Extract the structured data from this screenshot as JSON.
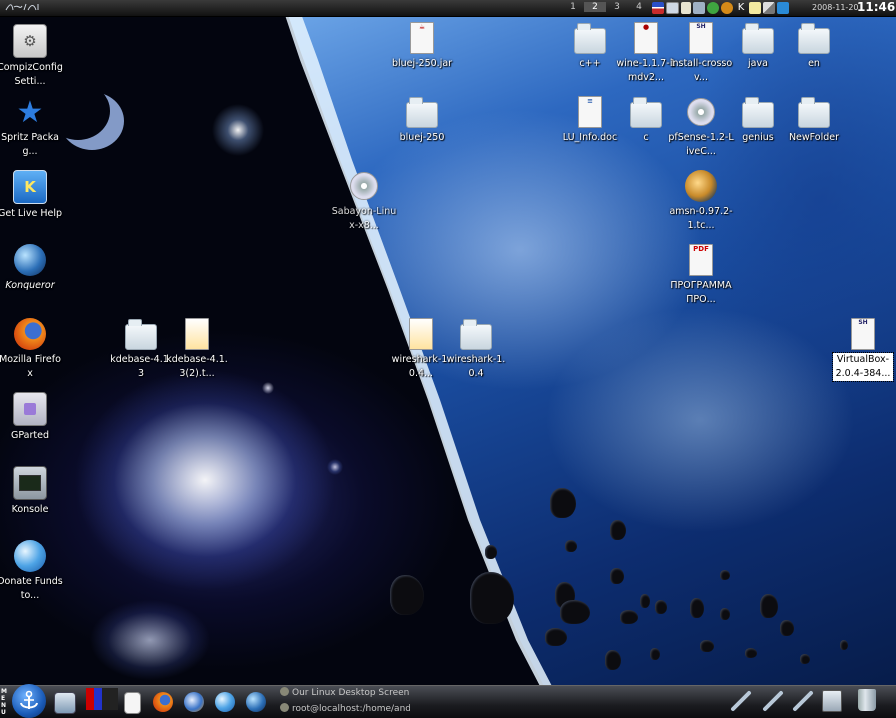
{
  "top_panel": {
    "desktops": [
      "1",
      "2",
      "3",
      "4"
    ],
    "active_desktop": "2",
    "tray_icons": [
      "flag-icon",
      "screen-icon",
      "clipboard-icon",
      "printer-icon",
      "green-apple-icon",
      "gear-icon",
      "k-icon",
      "notes-icon",
      "network-icon",
      "notify-icon"
    ],
    "date": "2008-11-20",
    "time": "11:46"
  },
  "desktop": {
    "left_column": [
      {
        "label": "CompizConfig Setti...",
        "icon": "compiz-config-icon"
      },
      {
        "label": "Spritz Packag...",
        "icon": "star-icon"
      },
      {
        "label": "Get Live Help",
        "icon": "k-help-icon"
      },
      {
        "label": "Konqueror",
        "icon": "konqueror-icon"
      },
      {
        "label": "Mozilla Firefox",
        "icon": "firefox-icon"
      },
      {
        "label": "GParted",
        "icon": "gparted-icon"
      },
      {
        "label": "Konsole",
        "icon": "konsole-icon"
      },
      {
        "label": "Donate Funds to...",
        "icon": "globe-icon"
      }
    ],
    "middle": [
      {
        "label": "kdebase-4.1.3",
        "icon": "folder-icon"
      },
      {
        "label": "kdebase-4.1.3(2).t...",
        "icon": "archive-icon"
      },
      {
        "label": "bluej-250.jar",
        "icon": "java-file-icon"
      },
      {
        "label": "bluej-250",
        "icon": "folder-icon"
      },
      {
        "label": "Sabayon-Linux-x8...",
        "icon": "disc-image-icon"
      },
      {
        "label": "wireshark-1.0.4...",
        "icon": "archive-icon"
      },
      {
        "label": "wireshark-1.0.4",
        "icon": "folder-icon"
      }
    ],
    "right_grid": [
      {
        "label": "c++",
        "icon": "folder-icon"
      },
      {
        "label": "wine-1.1.7-1mdv2...",
        "icon": "rpm-icon"
      },
      {
        "label": "install-crossov...",
        "icon": "script-icon"
      },
      {
        "label": "java",
        "icon": "folder-icon"
      },
      {
        "label": "en",
        "icon": "folder-icon"
      },
      {
        "label": "LU_Info.doc",
        "icon": "doc-file-icon"
      },
      {
        "label": "c",
        "icon": "folder-icon"
      },
      {
        "label": "pfSense-1.2-LiveC...",
        "icon": "disc-image-icon"
      },
      {
        "label": "genius",
        "icon": "folder-icon"
      },
      {
        "label": "NewFolder",
        "icon": "folder-icon"
      },
      {
        "label": "amsn-0.97.2-1.tc...",
        "icon": "package-icon"
      },
      {
        "label": "ПРОГРАММА ПРО...",
        "icon": "pdf-file-icon"
      },
      {
        "label": "VirtualBox-2.0.4-384...",
        "icon": "script-icon"
      }
    ]
  },
  "taskbar": {
    "menu_label": "MENU",
    "tasks": [
      "Our Linux Desktop Screen",
      "root@localhost:/home/and"
    ]
  },
  "colors": {
    "panel": "#1b1c20",
    "k_button": "#1a5bb8",
    "planet": "#2d68c0"
  }
}
